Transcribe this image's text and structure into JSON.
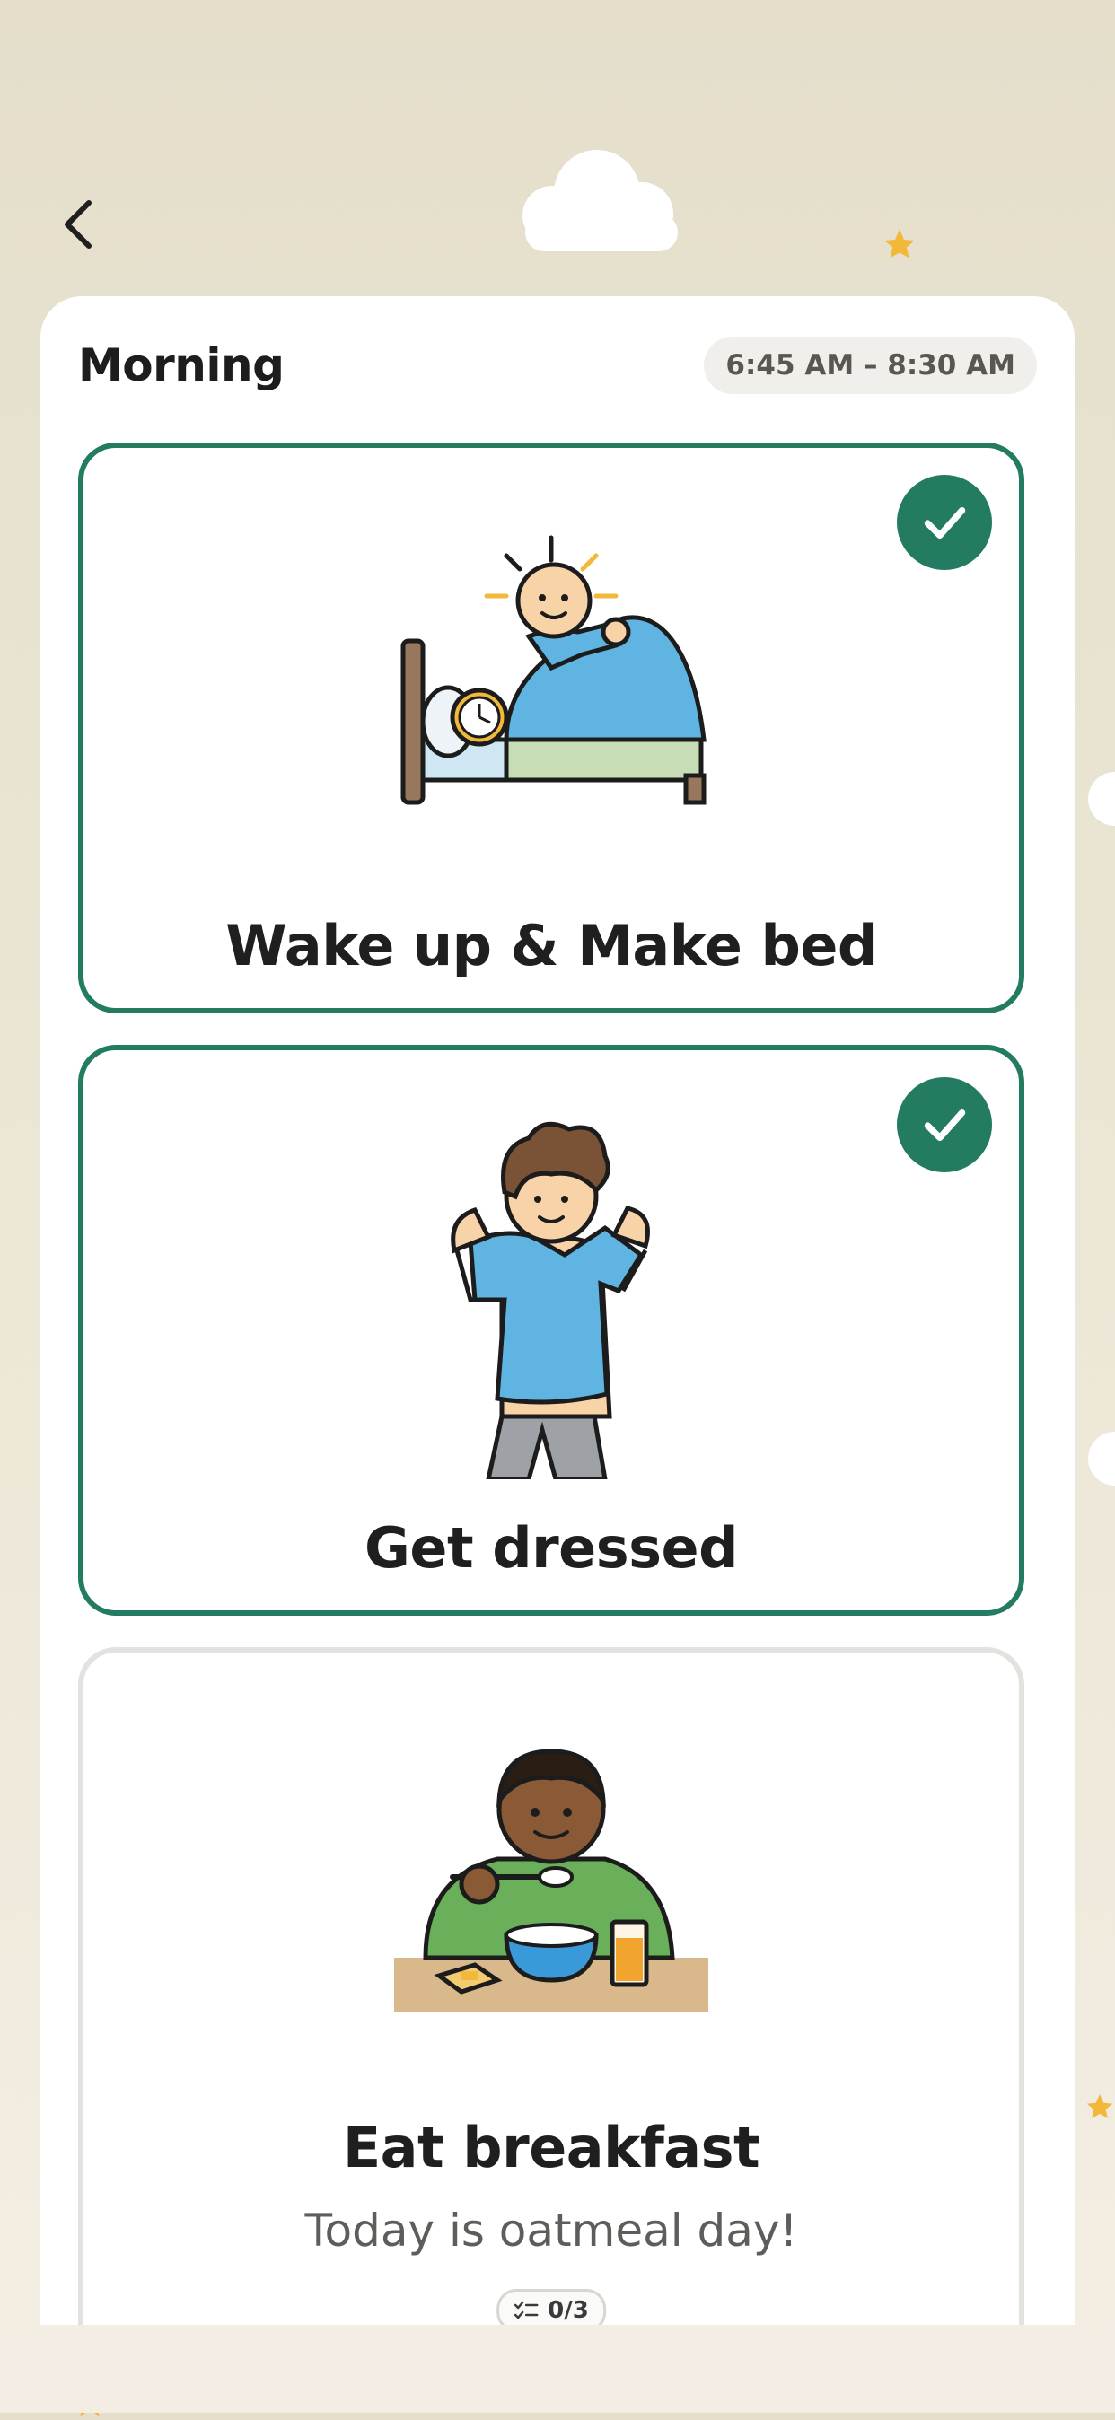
{
  "header": {
    "back_label": "Back"
  },
  "routine": {
    "title": "Morning",
    "time_range": "6:45 AM – 8:30 AM"
  },
  "tasks": [
    {
      "title": "Wake up & Make bed",
      "status": "completed"
    },
    {
      "title": "Get dressed",
      "status": "completed"
    },
    {
      "title": "Eat breakfast",
      "subtitle": "Today is oatmeal day!",
      "progress": "0/3",
      "status": "pending"
    }
  ],
  "colors": {
    "accent": "#237b62",
    "background": "#e4decb",
    "star": "#f1b83a"
  },
  "icons": {
    "back": "chevron-left-icon",
    "check": "check-icon",
    "checklist": "checklist-icon"
  }
}
